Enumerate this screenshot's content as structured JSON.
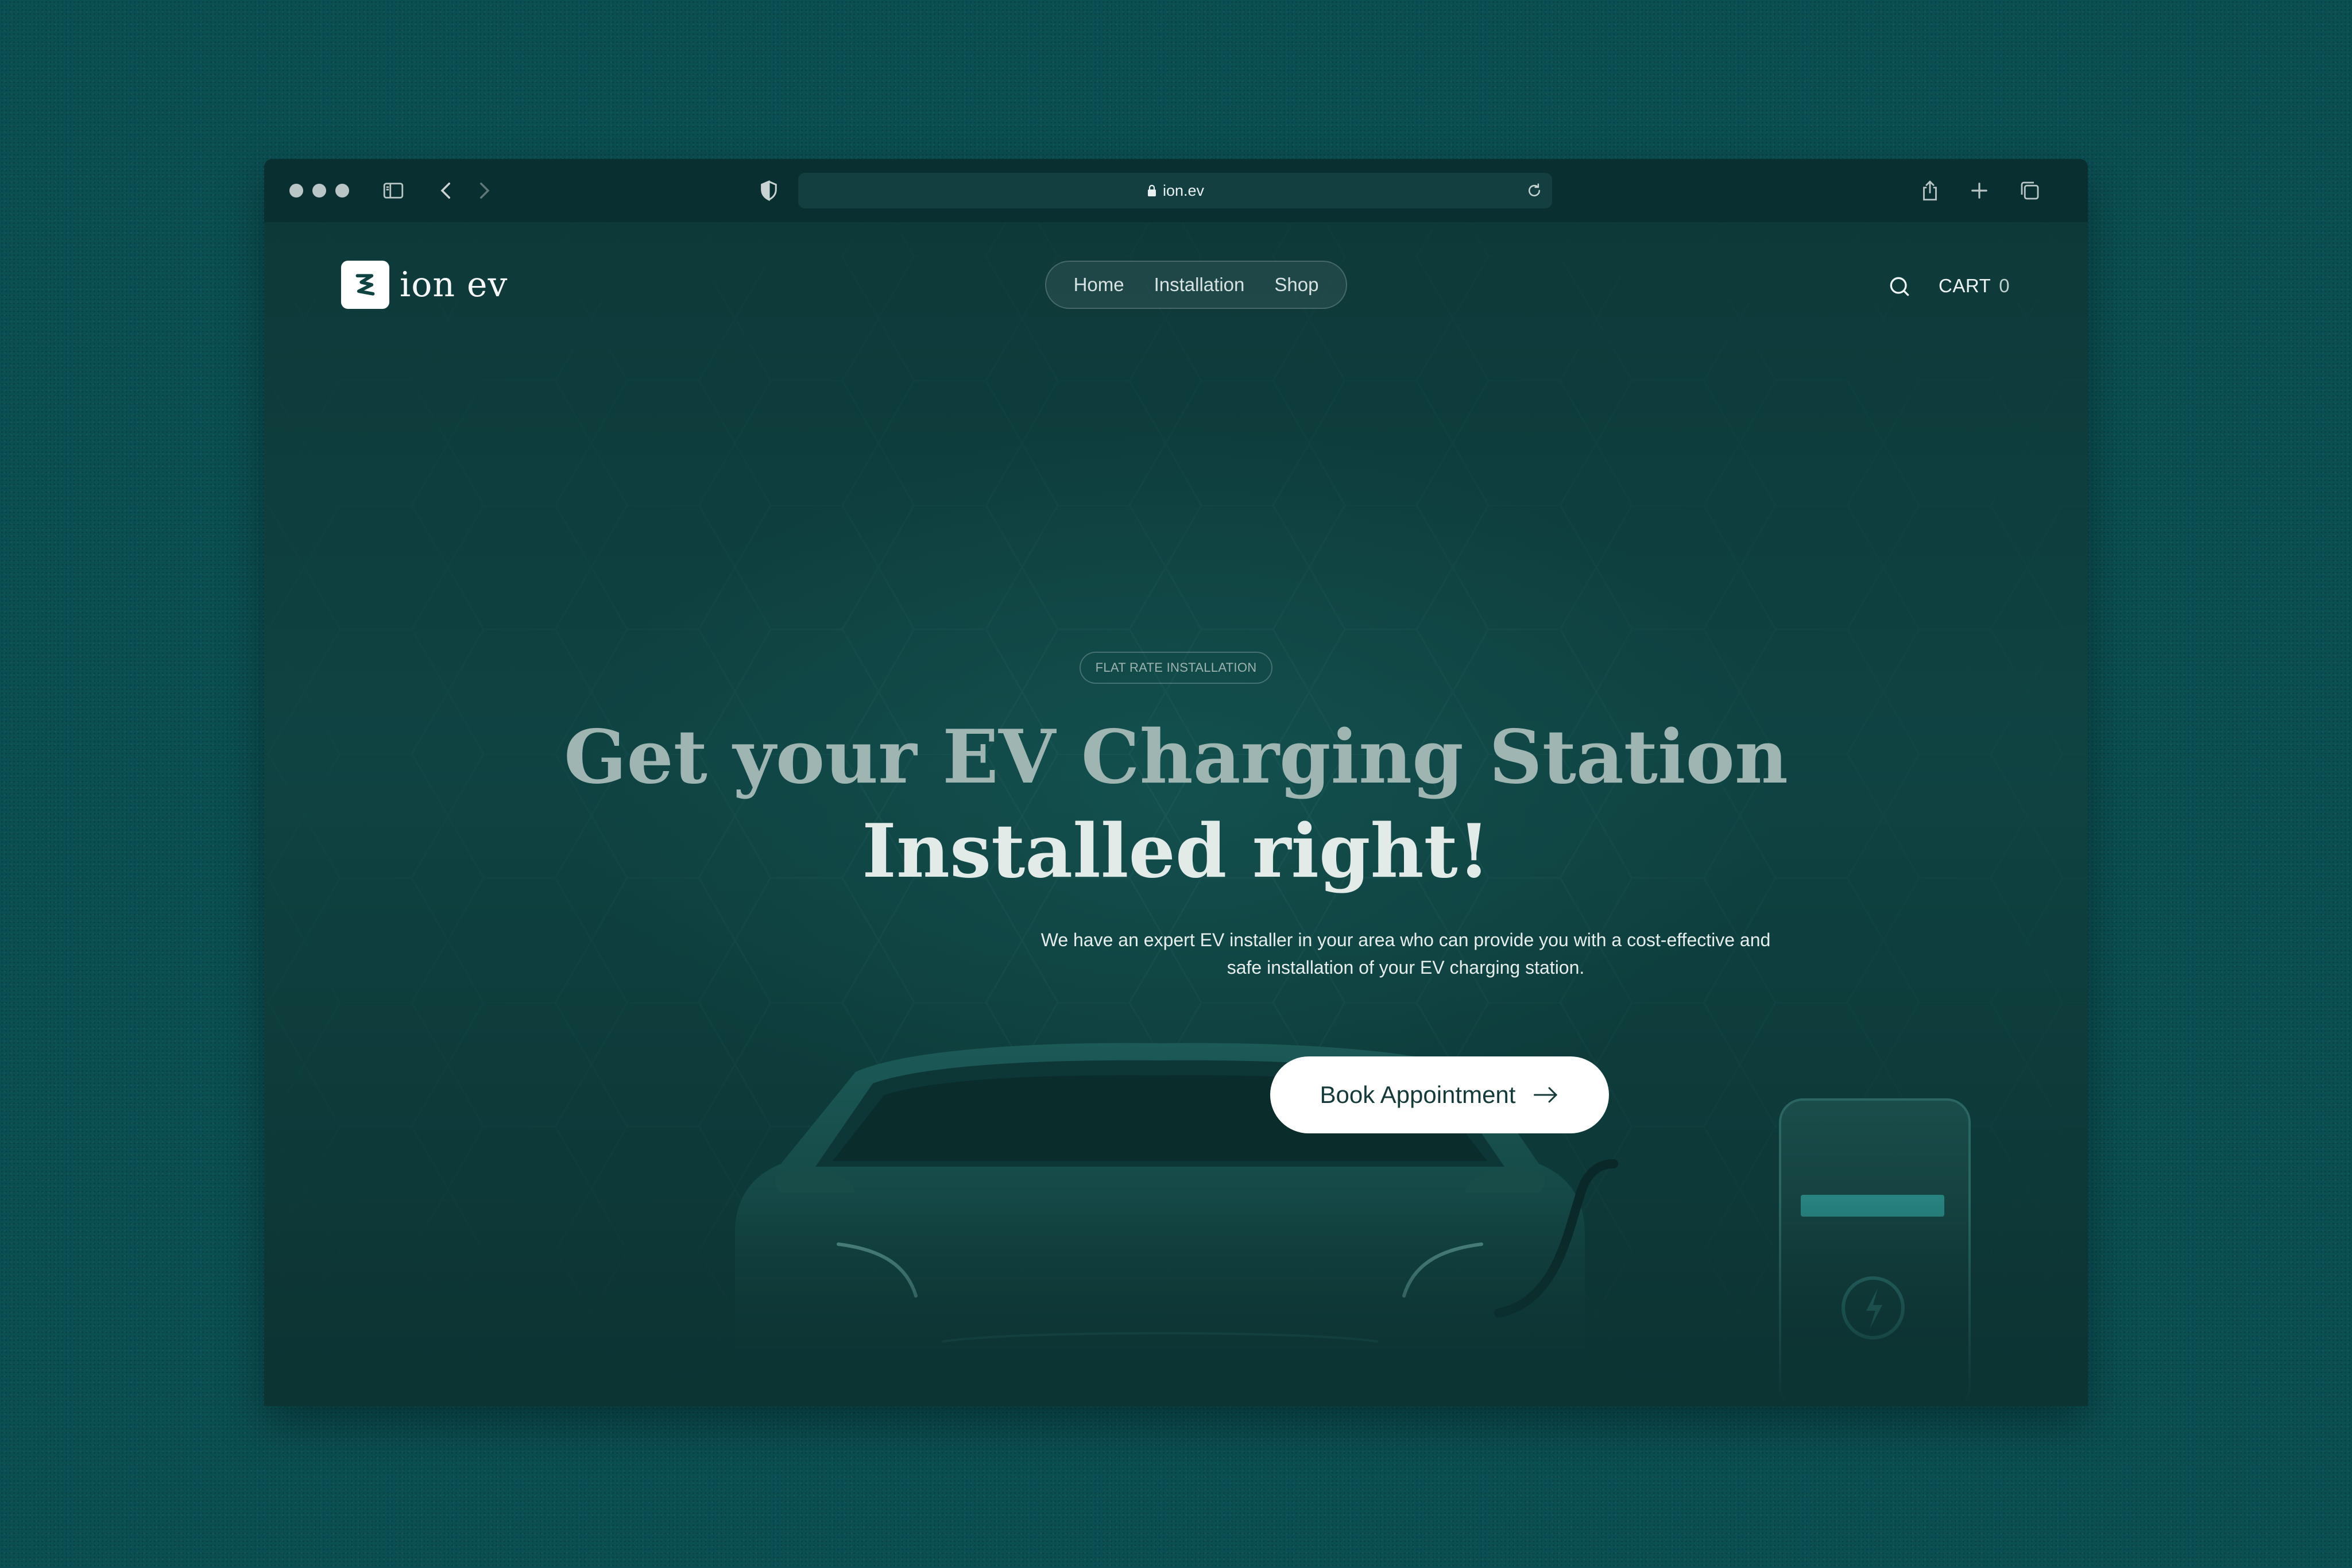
{
  "browser": {
    "url": "ion.ev"
  },
  "site": {
    "logo_text": "ion ev"
  },
  "nav": {
    "items": [
      {
        "label": "Home"
      },
      {
        "label": "Installation"
      },
      {
        "label": "Shop"
      }
    ]
  },
  "header": {
    "cart_label": "CART",
    "cart_count": "0"
  },
  "hero": {
    "badge": "FLAT RATE INSTALLATION",
    "headline_line1": "Get your EV Charging Station",
    "headline_line2": "Installed right!",
    "subtitle": "We have an expert EV installer in your area who can provide you with a cost-effective and safe installation of your EV charging station.",
    "cta_label": "Book Appointment"
  },
  "colors": {
    "background": "#0b4f53",
    "page": "#0f4342",
    "cta_bg": "#ffffff",
    "accent": "#2a8a86"
  },
  "icons": [
    "sidebar-icon",
    "back-icon",
    "forward-icon",
    "shield-icon",
    "lock-icon",
    "reload-icon",
    "download-icon",
    "share-icon",
    "new-tab-icon",
    "tabs-icon",
    "search-icon",
    "arrow-right-icon",
    "bolt-icon"
  ]
}
